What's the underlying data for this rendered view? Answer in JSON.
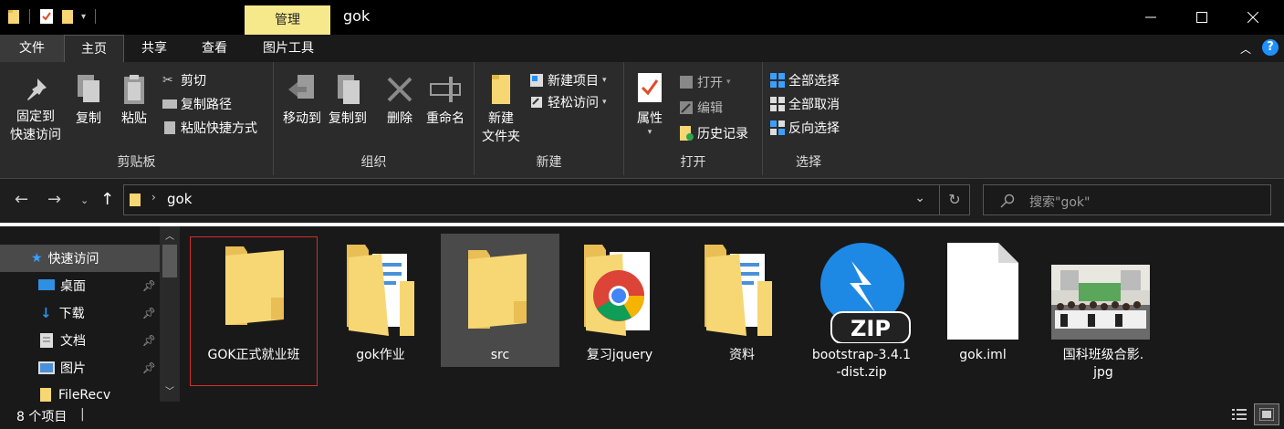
{
  "titlebar": {
    "context_tab": "管理",
    "title": "gok",
    "minimize": "—",
    "maximize": "☐",
    "close": "✕"
  },
  "tabs": {
    "file": "文件",
    "home": "主页",
    "share": "共享",
    "view": "查看",
    "picture_tools": "图片工具",
    "help": "?"
  },
  "ribbon": {
    "clipboard": {
      "label": "剪贴板",
      "pin_line1": "固定到",
      "pin_line2": "快速访问",
      "copy": "复制",
      "paste": "粘贴",
      "cut": "剪切",
      "copy_path": "复制路径",
      "paste_shortcut": "粘贴快捷方式"
    },
    "organize": {
      "label": "组织",
      "move_to": "移动到",
      "copy_to": "复制到",
      "delete": "删除",
      "rename": "重命名"
    },
    "new": {
      "label": "新建",
      "new_folder_line1": "新建",
      "new_folder_line2": "文件夹",
      "new_item": "新建项目",
      "easy_access": "轻松访问"
    },
    "open": {
      "label": "打开",
      "properties": "属性",
      "open": "打开",
      "edit": "编辑",
      "history": "历史记录"
    },
    "select": {
      "label": "选择",
      "select_all": "全部选择",
      "select_none": "全部取消",
      "invert": "反向选择"
    }
  },
  "address": {
    "path": "gok",
    "search_placeholder": "搜索\"gok\""
  },
  "navpane": {
    "items": [
      {
        "label": "快速访问"
      },
      {
        "label": "桌面"
      },
      {
        "label": "下载"
      },
      {
        "label": "文档"
      },
      {
        "label": "图片"
      },
      {
        "label": "FileRecv"
      }
    ]
  },
  "files": [
    {
      "name": "GOK正式就业班",
      "type": "folder"
    },
    {
      "name": "gok作业",
      "type": "folder-docs"
    },
    {
      "name": "src",
      "type": "folder"
    },
    {
      "name": "复习jquery",
      "type": "chrome-folder"
    },
    {
      "name": "资料",
      "type": "folder-docs"
    },
    {
      "name": "bootstrap-3.4.1-dist.zip",
      "line1": "bootstrap-3.4.1",
      "line2": "-dist.zip",
      "type": "zip"
    },
    {
      "name": "gok.iml",
      "type": "file"
    },
    {
      "name": "国科班级合影.jpg",
      "line1": "国科班级合影.",
      "line2": "jpg",
      "type": "image"
    }
  ],
  "status": {
    "count": "8 个项目"
  },
  "colors": {
    "context_tab_bg": "#f6e98c",
    "folder_yellow": "#f7d774",
    "selection_border": "#d42c2c",
    "accent_blue": "#1e90ff"
  }
}
